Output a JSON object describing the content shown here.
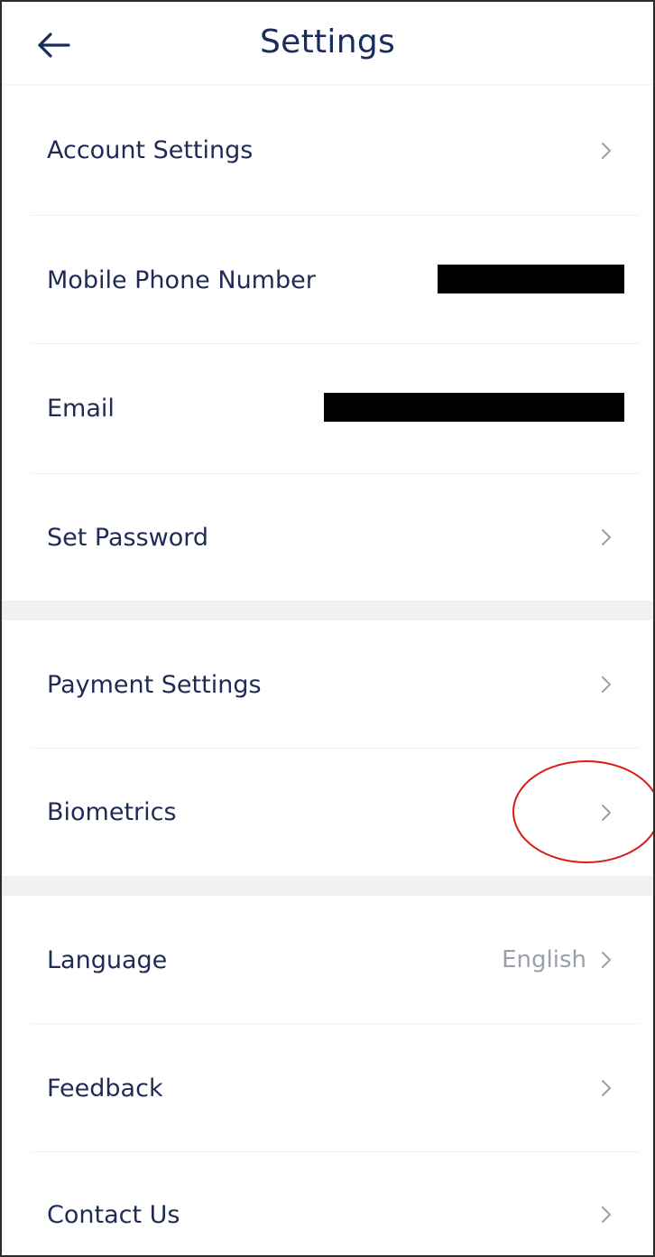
{
  "header": {
    "title": "Settings",
    "back_icon": "arrow-left-icon"
  },
  "rows": {
    "account_settings": {
      "label": "Account Settings"
    },
    "mobile_phone": {
      "label": "Mobile Phone Number"
    },
    "email": {
      "label": "Email"
    },
    "set_password": {
      "label": "Set Password"
    },
    "payment_settings": {
      "label": "Payment Settings"
    },
    "biometrics": {
      "label": "Biometrics"
    },
    "language": {
      "label": "Language",
      "value": "English"
    },
    "feedback": {
      "label": "Feedback"
    },
    "contact_us": {
      "label": "Contact Us"
    }
  },
  "colors": {
    "text": "#1e2b55",
    "muted": "#9aa0a8",
    "divider": "#eef0f3",
    "section_gap": "#f0f1f3",
    "annotation": "#d81a1a"
  }
}
